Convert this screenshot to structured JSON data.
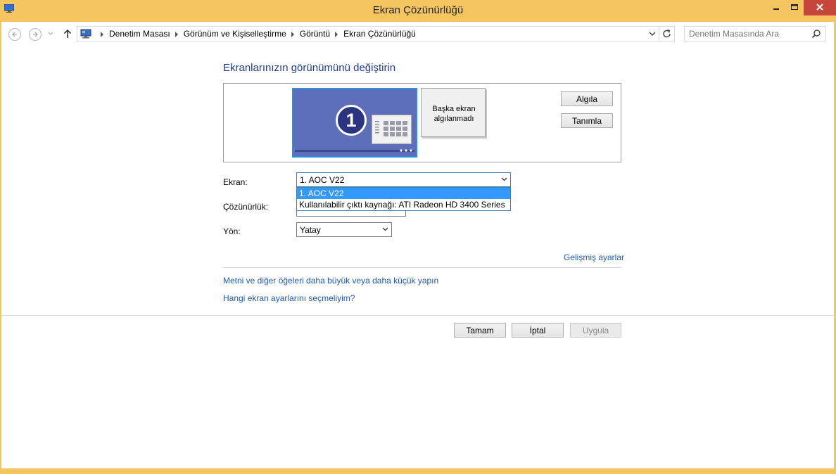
{
  "window": {
    "title": "Ekran Çözünürlüğü",
    "accent": "#f5c660"
  },
  "toolbar": {
    "back_icon": "back-arrow-icon",
    "forward_icon": "forward-arrow-icon",
    "up_icon": "up-arrow-icon",
    "breadcrumbs": [
      "Denetim Masası",
      "Görünüm ve Kişiselleştirme",
      "Görüntü",
      "Ekran Çözünürlüğü"
    ],
    "search_placeholder": "Denetim Masasında Ara"
  },
  "main": {
    "heading": "Ekranlarınızın görünümünü değiştirin",
    "monitor1_number": "1",
    "monitor2_text": "Başka ekran algılanmadı",
    "detect_button": "Algıla",
    "identify_button": "Tanımla",
    "display_label": "Ekran:",
    "display_value": "1. AOC V22",
    "display_options": [
      "1. AOC V22",
      "Kullanılabilir çıktı kaynağı: ATI Radeon HD 3400 Series"
    ],
    "resolution_label": "Çözünürlük:",
    "orientation_label": "Yön:",
    "orientation_value": "Yatay",
    "advanced_link": "Gelişmiş ayarlar",
    "text_size_link": "Metni ve diğer öğeleri daha büyük veya daha küçük yapın",
    "help_link": "Hangi ekran ayarlarını seçmeliyim?",
    "ok_button": "Tamam",
    "cancel_button": "İptal",
    "apply_button": "Uygula",
    "link_color": "#1e5ab4",
    "heading_color": "#1e3e8f"
  }
}
